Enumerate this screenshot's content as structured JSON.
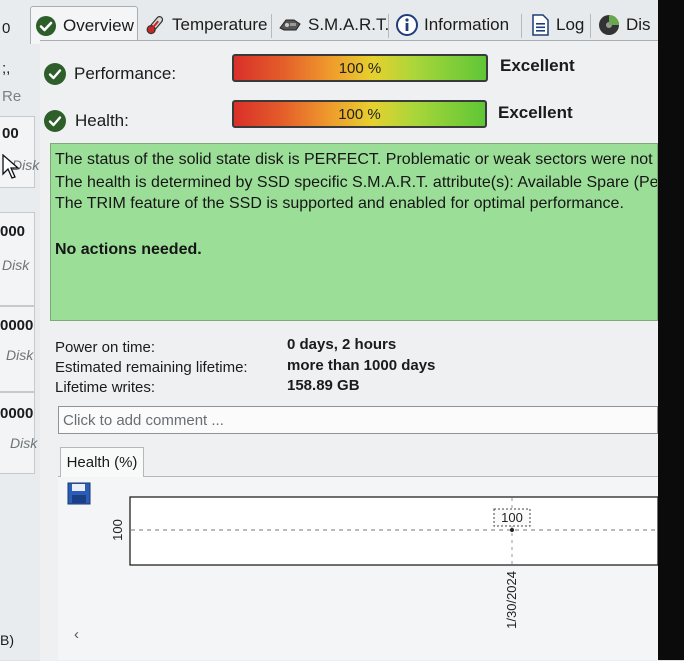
{
  "drive_list": {
    "frag_top": "0",
    "frag_semicolon": ";,",
    "frag_re": "Re",
    "items": [
      {
        "number": "00",
        "sub": "Disk"
      },
      {
        "number": "000",
        "sub": "Disk"
      },
      {
        "number": "0000",
        "sub": "Disk"
      },
      {
        "number": "0000",
        "sub": "Disk"
      }
    ],
    "frag_bottom": "B)"
  },
  "tabs": [
    {
      "label": "Overview",
      "icon": "check-circle-icon",
      "active": true
    },
    {
      "label": "Temperature",
      "icon": "thermometer-icon",
      "active": false
    },
    {
      "label": "S.M.A.R.T.",
      "icon": "smart-icon",
      "active": false
    },
    {
      "label": "Information",
      "icon": "info-icon",
      "active": false
    },
    {
      "label": "Log",
      "icon": "log-document-icon",
      "active": false
    },
    {
      "label": "Dis",
      "icon": "disk-icon",
      "active": false
    }
  ],
  "performance": {
    "label": "Performance:",
    "percent_text": "100 %",
    "rating": "Excellent",
    "value": 100
  },
  "health": {
    "label": "Health:",
    "percent_text": "100 %",
    "rating": "Excellent",
    "value": 100
  },
  "status": {
    "line1": "The status of the solid state disk is PERFECT. Problematic or weak sectors were not",
    "line2": "The health is determined by SSD specific S.M.A.R.T. attribute(s):  Available Spare (Per",
    "line3": "The TRIM feature of the SSD is supported and enabled for optimal performance.",
    "actions": "No actions needed."
  },
  "info": {
    "power_on_label": "Power on time:",
    "power_on_value": "0 days, 2 hours",
    "remaining_label": "Estimated remaining lifetime:",
    "remaining_value": "more than 1000 days",
    "writes_label": "Lifetime writes:",
    "writes_value": "158.89 GB"
  },
  "comment": {
    "placeholder": "Click to add comment ..."
  },
  "chart_tab": {
    "label": "Health (%)"
  },
  "colors": {
    "status_bg": "#9bde98",
    "check_green": "#2e5e2a"
  },
  "chart_data": {
    "type": "line",
    "x": [
      "1/30/2024"
    ],
    "values": [
      100
    ],
    "y_tick_labels": [
      "100"
    ],
    "point_labels": [
      "100"
    ],
    "grid": true
  }
}
